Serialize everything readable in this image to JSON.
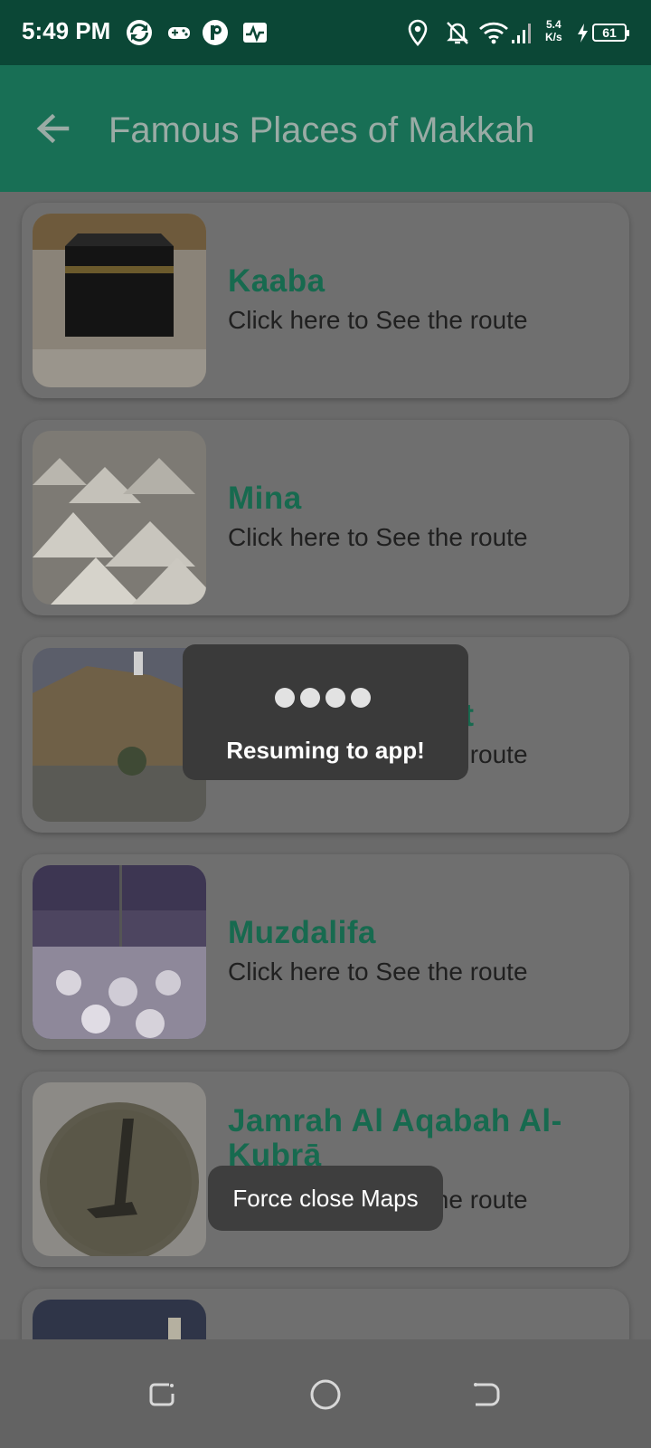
{
  "status_bar": {
    "time": "5:49 PM",
    "net_speed_value": "5.4",
    "net_speed_unit": "K/s",
    "battery": "61",
    "icons": [
      "sync-icon",
      "gamepad-icon",
      "p-icon",
      "activity-icon",
      "location-icon",
      "bell-off-icon",
      "wifi-icon",
      "signal-icon",
      "charging-icon"
    ]
  },
  "toolbar": {
    "title": "Famous Places of Makkah",
    "back_icon": "arrow-left-icon"
  },
  "places": [
    {
      "name": "Kaaba",
      "subtitle": "Click here to See the route"
    },
    {
      "name": "Mina",
      "subtitle": "Click here to See the route"
    },
    {
      "name": "Mountain Arafat",
      "subtitle": "Click here to See the route"
    },
    {
      "name": "Muzdalifa",
      "subtitle": "Click here to See the route"
    },
    {
      "name": "Jamrah Al Aqabah Al-Kubrā",
      "subtitle": "Click here to See the route"
    }
  ],
  "loading_dialog": {
    "message": "Resuming to app!"
  },
  "toast": {
    "message": "Force close Maps"
  },
  "nav_bar": {
    "buttons": [
      "recent-apps-icon",
      "home-icon",
      "back-nav-icon"
    ]
  },
  "colors": {
    "status_bar": "#0b4736",
    "toolbar": "#186f55",
    "accent_green": "#176a4f"
  }
}
